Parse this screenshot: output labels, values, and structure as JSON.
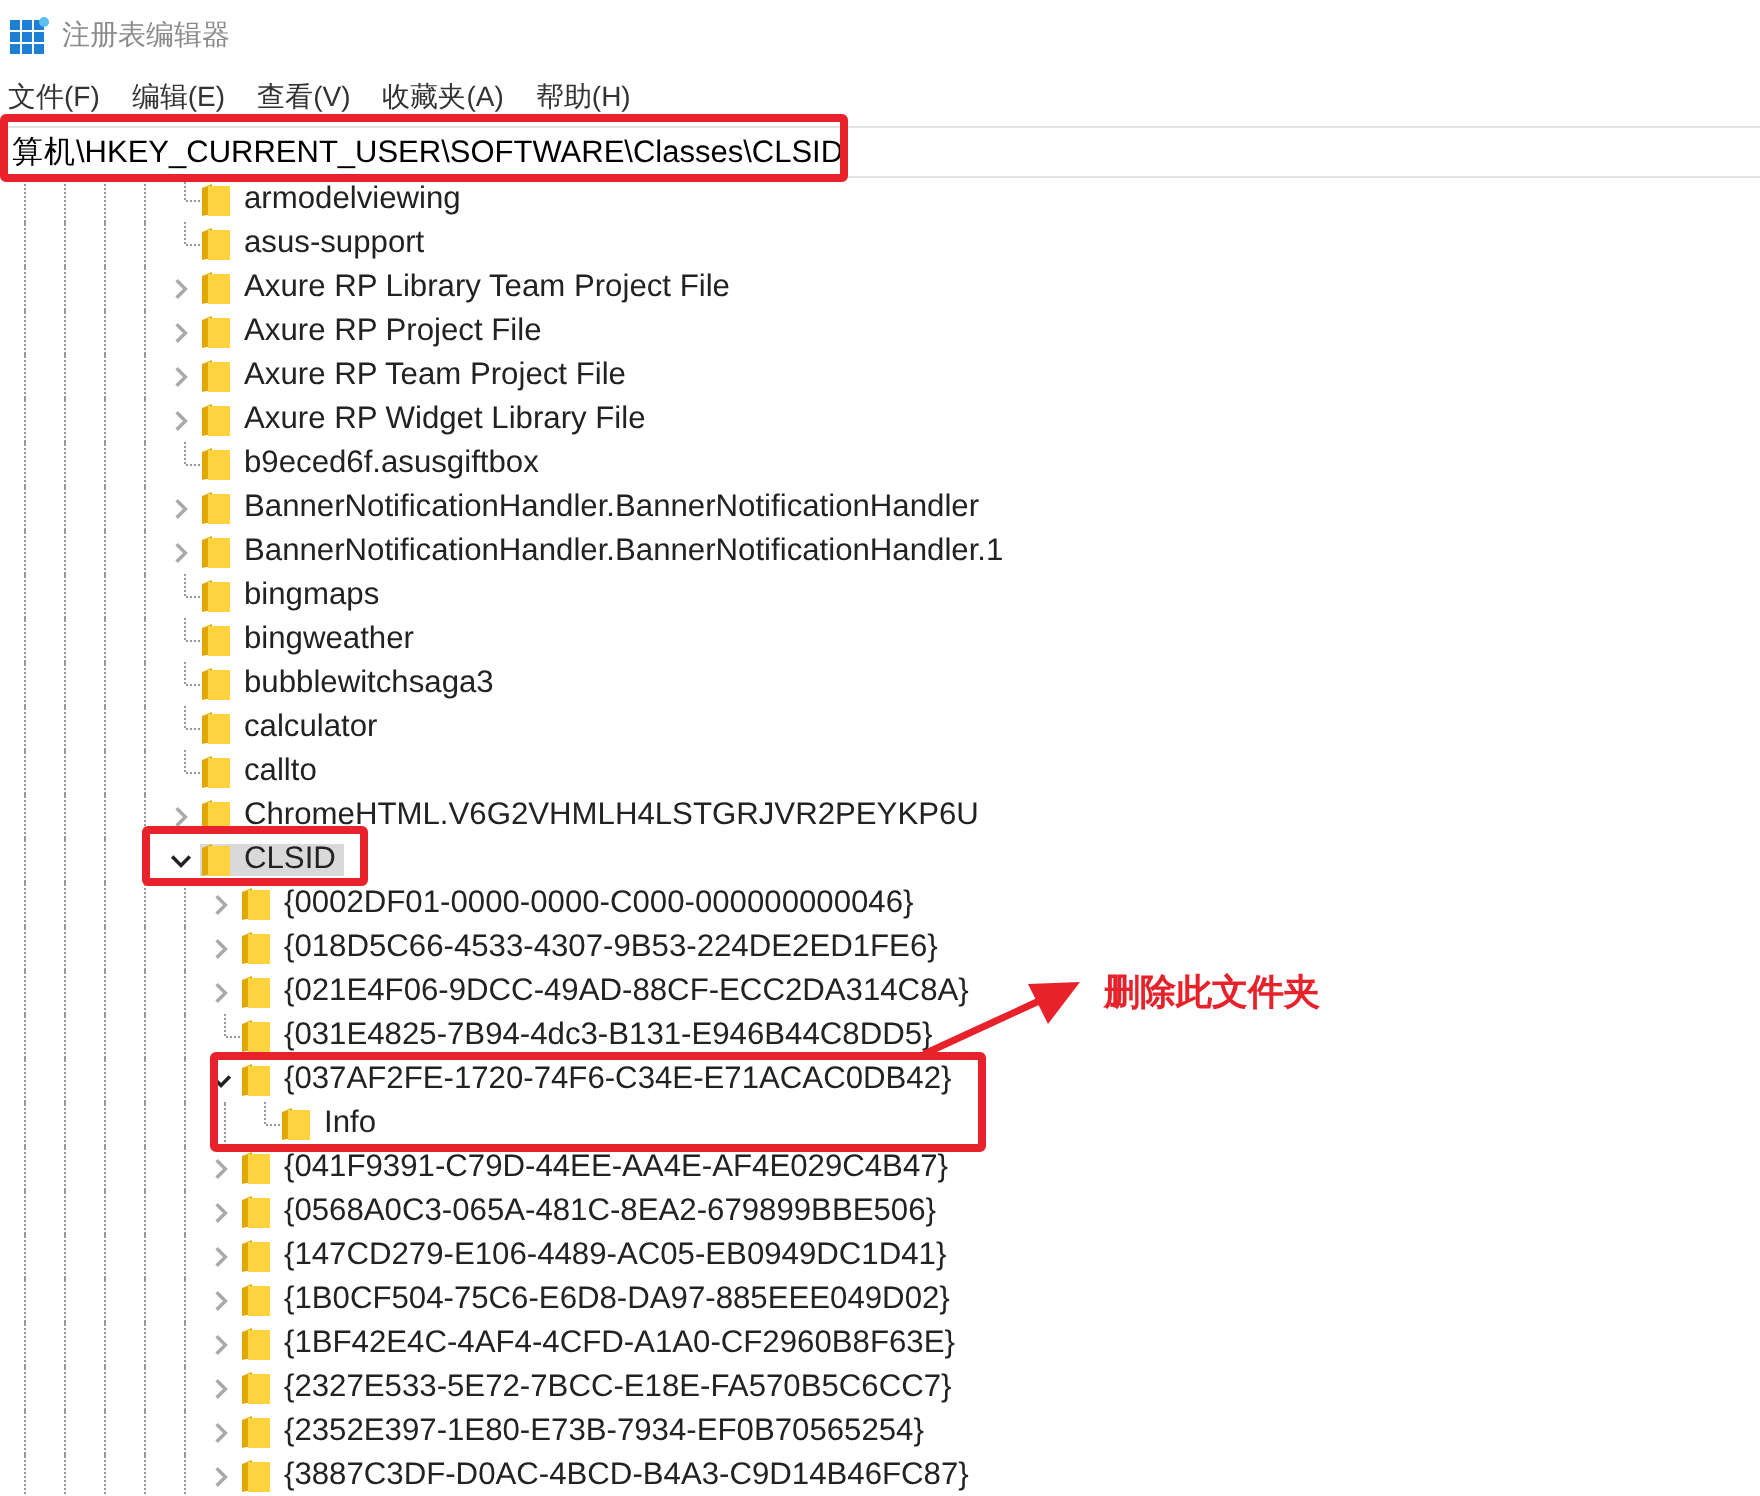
{
  "window": {
    "title": "注册表编辑器"
  },
  "menu": [
    "文件(F)",
    "编辑(E)",
    "查看(V)",
    "收藏夹(A)",
    "帮助(H)"
  ],
  "address_bar": {
    "value": "算机\\HKEY_CURRENT_USER\\SOFTWARE\\Classes\\CLSID"
  },
  "tree": [
    {
      "label": "armodelviewing",
      "expandable": false,
      "expanded": false,
      "selected": false
    },
    {
      "label": "asus-support",
      "expandable": false,
      "expanded": false,
      "selected": false
    },
    {
      "label": "Axure RP Library Team Project File",
      "expandable": true,
      "expanded": false,
      "selected": false
    },
    {
      "label": "Axure RP Project File",
      "expandable": true,
      "expanded": false,
      "selected": false
    },
    {
      "label": "Axure RP Team Project File",
      "expandable": true,
      "expanded": false,
      "selected": false
    },
    {
      "label": "Axure RP Widget Library File",
      "expandable": true,
      "expanded": false,
      "selected": false
    },
    {
      "label": "b9eced6f.asusgiftbox",
      "expandable": false,
      "expanded": false,
      "selected": false
    },
    {
      "label": "BannerNotificationHandler.BannerNotificationHandler",
      "expandable": true,
      "expanded": false,
      "selected": false
    },
    {
      "label": "BannerNotificationHandler.BannerNotificationHandler.1",
      "expandable": true,
      "expanded": false,
      "selected": false
    },
    {
      "label": "bingmaps",
      "expandable": false,
      "expanded": false,
      "selected": false
    },
    {
      "label": "bingweather",
      "expandable": false,
      "expanded": false,
      "selected": false
    },
    {
      "label": "bubblewitchsaga3",
      "expandable": false,
      "expanded": false,
      "selected": false
    },
    {
      "label": "calculator",
      "expandable": false,
      "expanded": false,
      "selected": false
    },
    {
      "label": "callto",
      "expandable": false,
      "expanded": false,
      "selected": false
    },
    {
      "label": "ChromeHTML.V6G2VHMLH4LSTGRJVR2PEYKP6U",
      "expandable": true,
      "expanded": false,
      "selected": false
    },
    {
      "label": "CLSID",
      "expandable": true,
      "expanded": true,
      "selected": true,
      "children": [
        {
          "label": "{0002DF01-0000-0000-C000-000000000046}",
          "expandable": true,
          "expanded": false,
          "selected": false
        },
        {
          "label": "{018D5C66-4533-4307-9B53-224DE2ED1FE6}",
          "expandable": true,
          "expanded": false,
          "selected": false
        },
        {
          "label": "{021E4F06-9DCC-49AD-88CF-ECC2DA314C8A}",
          "expandable": true,
          "expanded": false,
          "selected": false
        },
        {
          "label": "{031E4825-7B94-4dc3-B131-E946B44C8DD5}",
          "expandable": false,
          "expanded": false,
          "selected": false
        },
        {
          "label": "{037AF2FE-1720-74F6-C34E-E71ACAC0DB42}",
          "expandable": true,
          "expanded": true,
          "selected": false,
          "children": [
            {
              "label": "Info",
              "expandable": false,
              "expanded": false,
              "selected": false
            }
          ]
        },
        {
          "label": "{041F9391-C79D-44EE-AA4E-AF4E029C4B47}",
          "expandable": true,
          "expanded": false,
          "selected": false
        },
        {
          "label": "{0568A0C3-065A-481C-8EA2-679899BBE506}",
          "expandable": true,
          "expanded": false,
          "selected": false
        },
        {
          "label": "{147CD279-E106-4489-AC05-EB0949DC1D41}",
          "expandable": true,
          "expanded": false,
          "selected": false
        },
        {
          "label": "{1B0CF504-75C6-E6D8-DA97-885EEE049D02}",
          "expandable": true,
          "expanded": false,
          "selected": false
        },
        {
          "label": "{1BF42E4C-4AF4-4CFD-A1A0-CF2960B8F63E}",
          "expandable": true,
          "expanded": false,
          "selected": false
        },
        {
          "label": "{2327E533-5E72-7BCC-E18E-FA570B5C6CC7}",
          "expandable": true,
          "expanded": false,
          "selected": false
        },
        {
          "label": "{2352E397-1E80-E73B-7934-EF0B70565254}",
          "expandable": true,
          "expanded": false,
          "selected": false
        },
        {
          "label": "{3887C3DF-D0AC-4BCD-B4A3-C9D14B46FC87}",
          "expandable": true,
          "expanded": false,
          "selected": false
        }
      ]
    }
  ],
  "annotation": {
    "text": "删除此文件夹"
  }
}
